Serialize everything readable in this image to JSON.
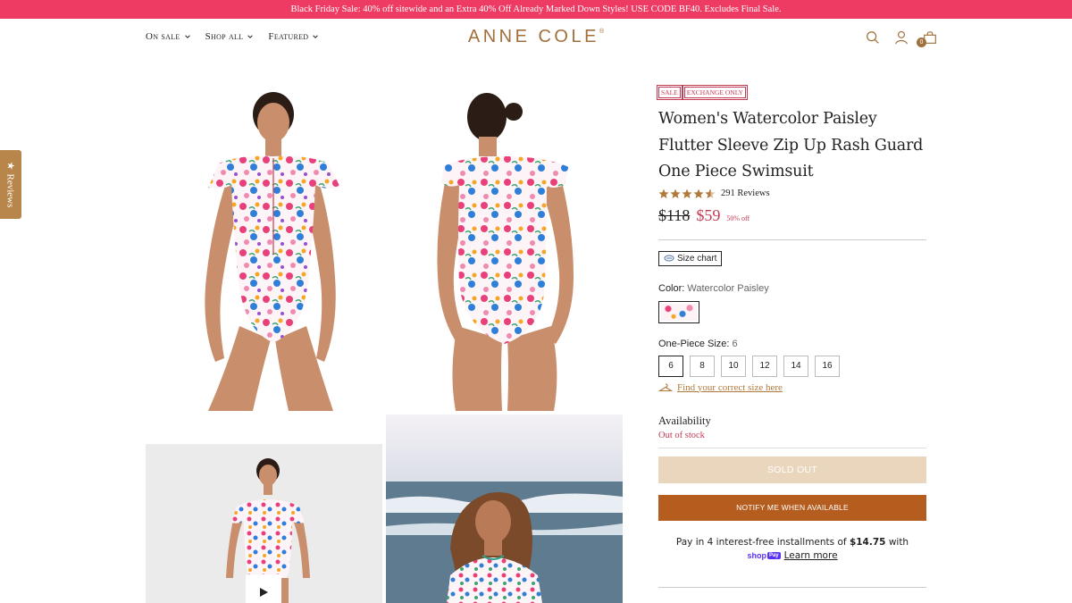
{
  "announcement": "Black Friday Sale: 40% off sitewide and an Extra 40% Off Already Marked Down Styles! USE CODE BF40. Excludes Final Sale.",
  "nav": [
    {
      "label": "On sale"
    },
    {
      "label": "Shop all"
    },
    {
      "label": "Featured"
    }
  ],
  "logo": {
    "text": "ANNE COLE",
    "mark": "®"
  },
  "header_icons": [
    "search-icon",
    "account-icon",
    "cart-icon"
  ],
  "cart_count": "0",
  "reviews_tab": {
    "label": "Reviews",
    "icon": "star-icon"
  },
  "gallery": {
    "images": [
      "model-front-image",
      "model-back-image",
      "video-thumbnail",
      "beach-lifestyle-image"
    ],
    "play_icon": "play-icon"
  },
  "product": {
    "badges": [
      "SALE",
      "EXCHANGE ONLY"
    ],
    "title": "Women's Watercolor Paisley Flutter Sleeve Zip Up Rash Guard One Piece Swimsuit",
    "rating": 4.5,
    "review_count": "291 Reviews",
    "price_original": "$118",
    "price_sale": "$59",
    "discount": "50% off",
    "size_chart_label": "Size chart",
    "color_label": "Color:",
    "color_value": "Watercolor Paisley",
    "size_label": "One-Piece Size:",
    "size_value": "6",
    "sizes": [
      "6",
      "8",
      "10",
      "12",
      "14",
      "16"
    ],
    "selected_size": "6",
    "find_size_link": "Find your correct size here",
    "availability_title": "Availability",
    "availability_value": "Out of stock",
    "sold_out_label": "SOLD OUT",
    "notify_label": "NOTIFY ME WHEN AVAILABLE",
    "shoppay": {
      "text_before": "Pay in 4 interest-free installments of",
      "amount": "$14.75",
      "text_after": "with",
      "brand": "shop",
      "brand_badge": "Pay",
      "learn_more": "Learn more"
    }
  },
  "colors": {
    "announcement_bg": "#ee3b63",
    "brand_gold": "#a0703c",
    "sale_red": "#c43a52",
    "sold_out_bg": "#ead5bd",
    "notify_bg": "#b45d1f",
    "star": "#b07a3c"
  }
}
